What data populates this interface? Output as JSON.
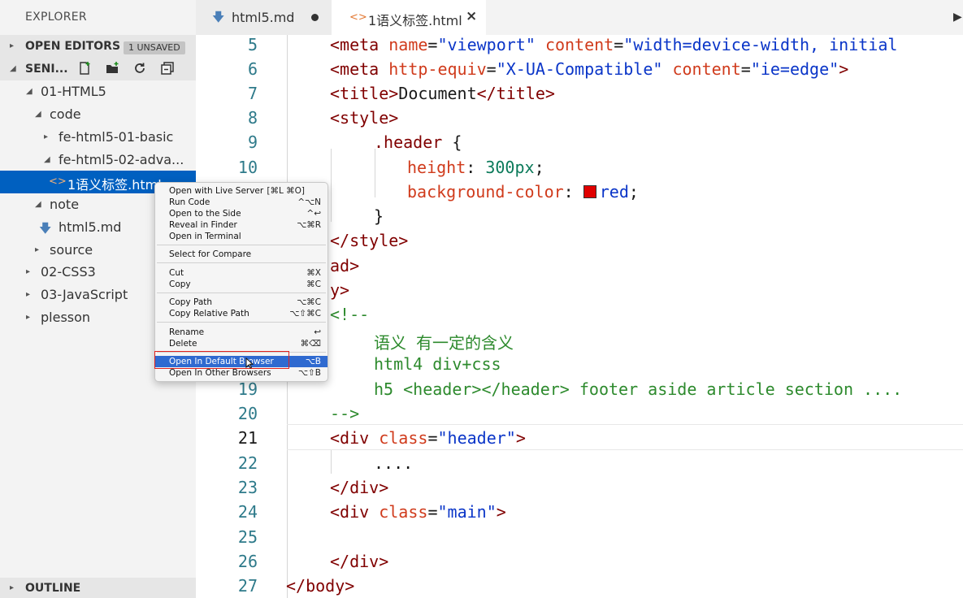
{
  "sidebar": {
    "title": "EXPLORER",
    "open_editors": {
      "label": "OPEN EDITORS",
      "badge": "1 UNSAVED"
    },
    "project": {
      "label": "SENI..."
    },
    "tree": [
      {
        "label": "01-HTML5",
        "twisty": "◢"
      },
      {
        "label": "code",
        "twisty": "◢"
      },
      {
        "label": "fe-html5-01-basic",
        "twisty": "▸"
      },
      {
        "label": "fe-html5-02-adva...",
        "twisty": "◢"
      },
      {
        "label": "1语义标签.html",
        "icon": "<>"
      },
      {
        "label": "note",
        "twisty": "◢"
      },
      {
        "label": "html5.md"
      },
      {
        "label": "source",
        "twisty": "▸"
      },
      {
        "label": "02-CSS3",
        "twisty": "▸"
      },
      {
        "label": "03-JavaScript",
        "twisty": "▸"
      },
      {
        "label": "plesson",
        "twisty": "▸"
      }
    ],
    "outline": {
      "label": "OUTLINE"
    }
  },
  "tabs": [
    {
      "label": "html5.md"
    },
    {
      "label": "1语义标签.html",
      "icon": "<>",
      "close": "×"
    }
  ],
  "gutter": [
    "5",
    "6",
    "7",
    "8",
    "9",
    "10",
    "19",
    "20",
    "21",
    "22",
    "23",
    "24",
    "25",
    "26",
    "27"
  ],
  "code": {
    "l5": {
      "t1": "<meta ",
      "a1": "name",
      "e1": "=",
      "v1": "\"viewport\"",
      "sp": " ",
      "a2": "content",
      "e2": "=",
      "v2": "\"width=device-width, initial"
    },
    "l6": {
      "t1": "<meta ",
      "a1": "http-equiv",
      "e1": "=",
      "v1": "\"X-UA-Compatible\"",
      "sp": " ",
      "a2": "content",
      "e2": "=",
      "v2": "\"ie=edge\"",
      "t2": ">"
    },
    "l7": {
      "t1": "<title>",
      "txt": "Document",
      "t2": "</title>"
    },
    "l8": {
      "t1": "<style>"
    },
    "l9": {
      "sel": ".header",
      "rest": " {"
    },
    "l10": {
      "p": "height",
      "c": ": ",
      "n": "300px",
      "s": ";"
    },
    "l11": {
      "p": "background-color",
      "c": ": ",
      "v": "red",
      "s": ";"
    },
    "l12": {
      "txt": "}"
    },
    "l13": {
      "t1": "</style>"
    },
    "l14": {
      "t1": "ad>"
    },
    "l15": {
      "t1": "y>"
    },
    "l16": {
      "t1": "<!--"
    },
    "l17": {
      "c": "语义 有一定的含义"
    },
    "l18": {
      "c": "html4 div+css"
    },
    "l19": {
      "c": "h5 <header></header> footer aside article section ...."
    },
    "l20": {
      "c": "-->"
    },
    "l21": {
      "t1": "<div ",
      "a1": "class",
      "e1": "=",
      "v1": "\"header\"",
      "t2": ">"
    },
    "l22": {
      "txt": "...."
    },
    "l23": {
      "t1": "</div>"
    },
    "l24": {
      "t1": "<div ",
      "a1": "class",
      "e1": "=",
      "v1": "\"main\"",
      "t2": ">"
    },
    "l26": {
      "t1": "</div>"
    },
    "l27": {
      "t1": "</body>"
    }
  },
  "context_menu": [
    {
      "label": "Open with Live Server",
      "shortcut": "[⌘L ⌘O]"
    },
    {
      "label": "Run Code",
      "shortcut": "^⌥N"
    },
    {
      "label": "Open to the Side",
      "shortcut": "^↩"
    },
    {
      "label": "Reveal in Finder",
      "shortcut": "⌥⌘R"
    },
    {
      "label": "Open in Terminal",
      "shortcut": ""
    },
    {
      "label": "Select for Compare",
      "shortcut": ""
    },
    {
      "label": "Cut",
      "shortcut": "⌘X"
    },
    {
      "label": "Copy",
      "shortcut": "⌘C"
    },
    {
      "label": "Copy Path",
      "shortcut": "⌥⌘C"
    },
    {
      "label": "Copy Relative Path",
      "shortcut": "⌥⇧⌘C"
    },
    {
      "label": "Rename",
      "shortcut": "↩"
    },
    {
      "label": "Delete",
      "shortcut": "⌘⌫"
    },
    {
      "label": "Open In Default Browser",
      "shortcut": "⌥B"
    },
    {
      "label": "Open In Other Browsers",
      "shortcut": "⌥⇧B"
    }
  ],
  "colors": {
    "selection": "#0060c0",
    "menu_highlight": "#2f6ad0",
    "annotation": "#e0221e"
  }
}
